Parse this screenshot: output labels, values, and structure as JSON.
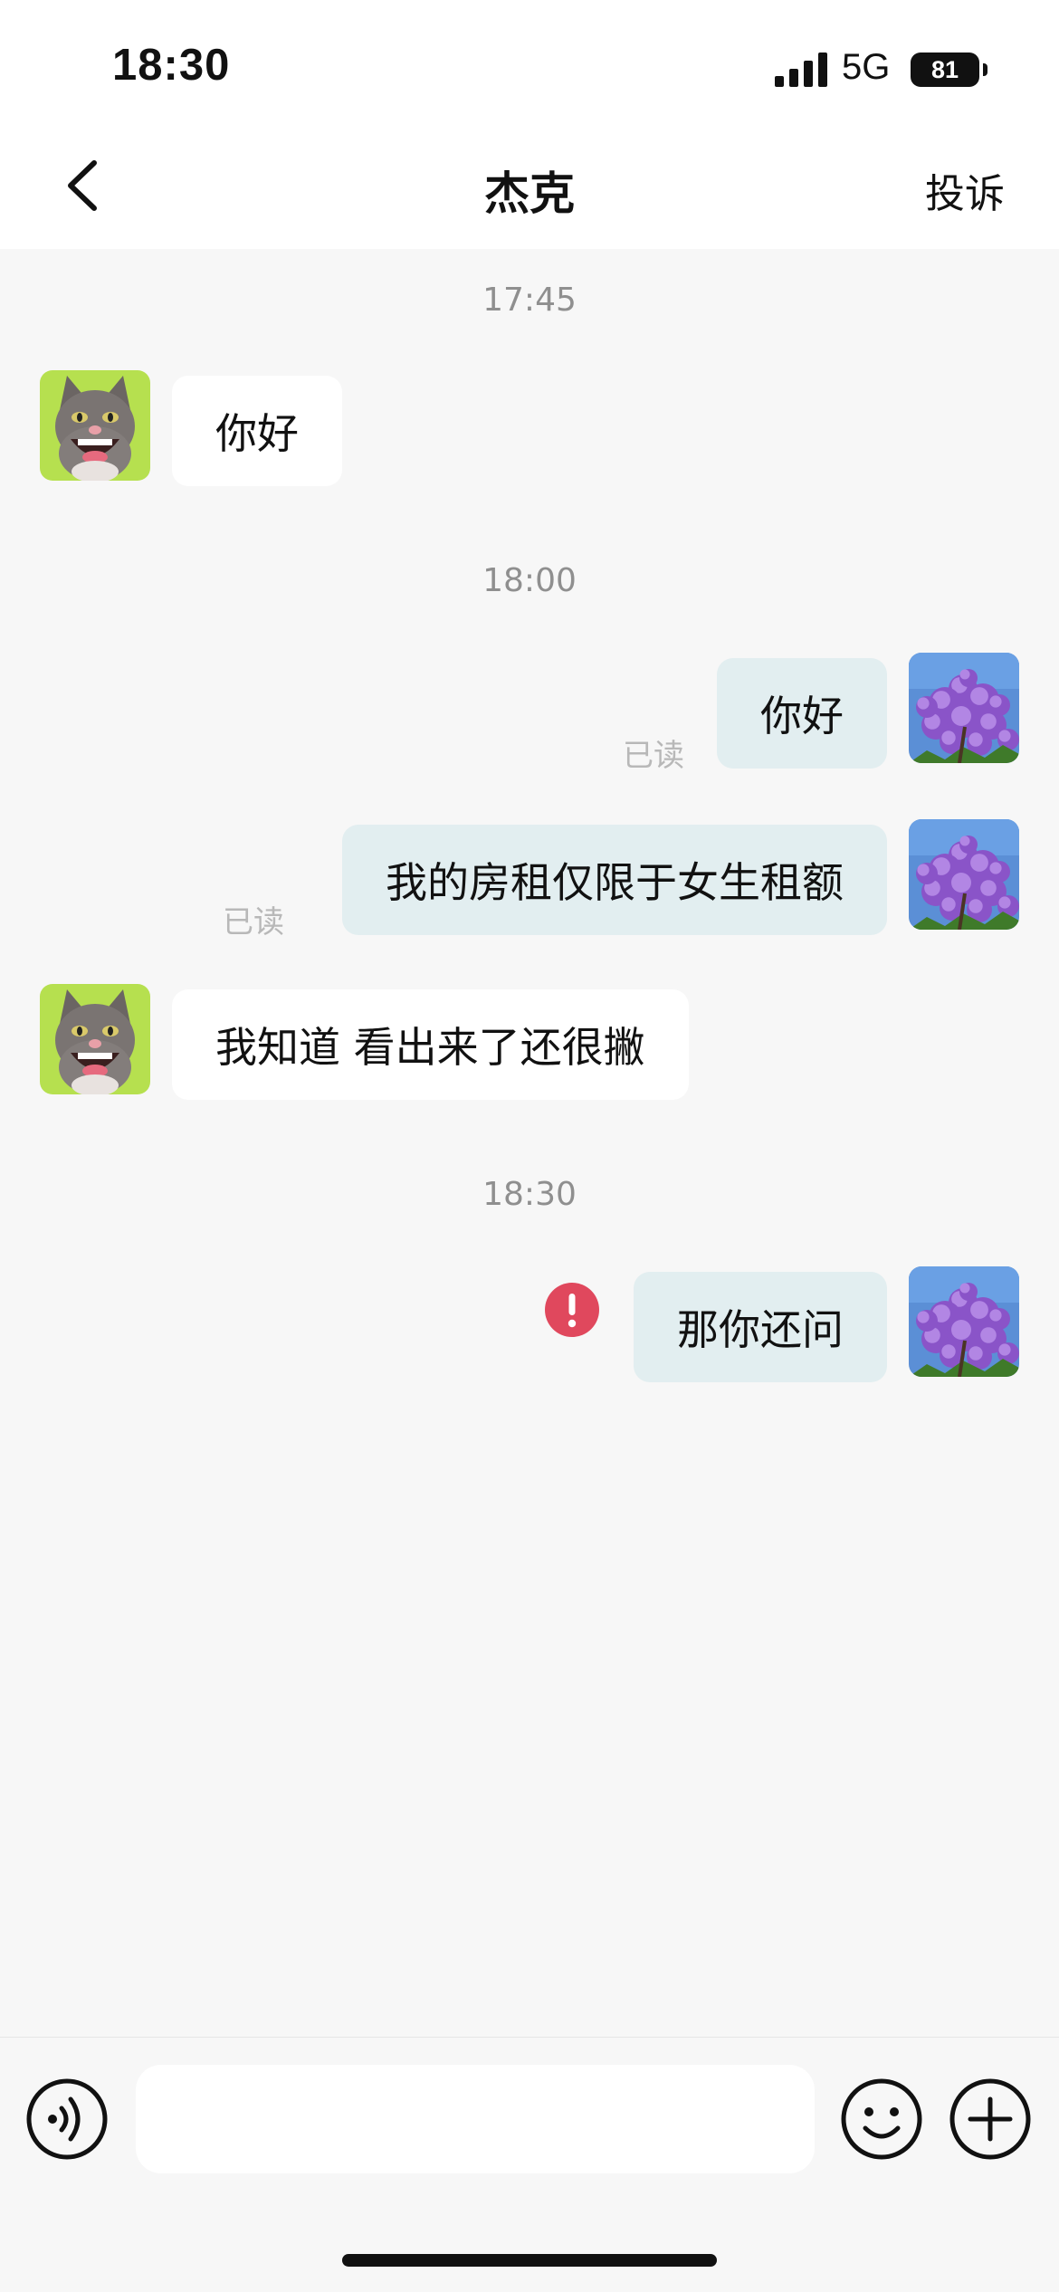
{
  "status_bar": {
    "time": "18:30",
    "network": "5G",
    "battery": "81",
    "icons": [
      "cellular-signal-icon",
      "battery-icon"
    ]
  },
  "header": {
    "title": "杰克",
    "complaint_label": "投诉",
    "back_icon": "chevron-left-icon"
  },
  "timestamps": [
    "17:45",
    "18:00",
    "18:30"
  ],
  "messages": [
    {
      "direction": "in",
      "text": "你好",
      "avatar": "cat-avatar"
    },
    {
      "direction": "out",
      "text": "你好",
      "status": "已读",
      "avatar": "purple-flowers-avatar"
    },
    {
      "direction": "out",
      "text": "我的房租仅限于女生租额",
      "status": "已读",
      "avatar": "purple-flowers-avatar"
    },
    {
      "direction": "in",
      "text": "我知道 看出来了还很撇",
      "avatar": "cat-avatar"
    },
    {
      "direction": "out",
      "text": "那你还问",
      "status_icon": "error-icon",
      "avatar": "purple-flowers-avatar"
    }
  ],
  "input_bar": {
    "placeholder": "",
    "value": "",
    "icons": [
      "voice-icon",
      "emoji-icon",
      "plus-icon"
    ]
  },
  "colors": {
    "background": "#f7f7f7",
    "outgoing_bubble": "#e2eef0",
    "incoming_bubble": "#ffffff",
    "error": "#e0485d",
    "read_receipt": "#b8b8b8"
  }
}
